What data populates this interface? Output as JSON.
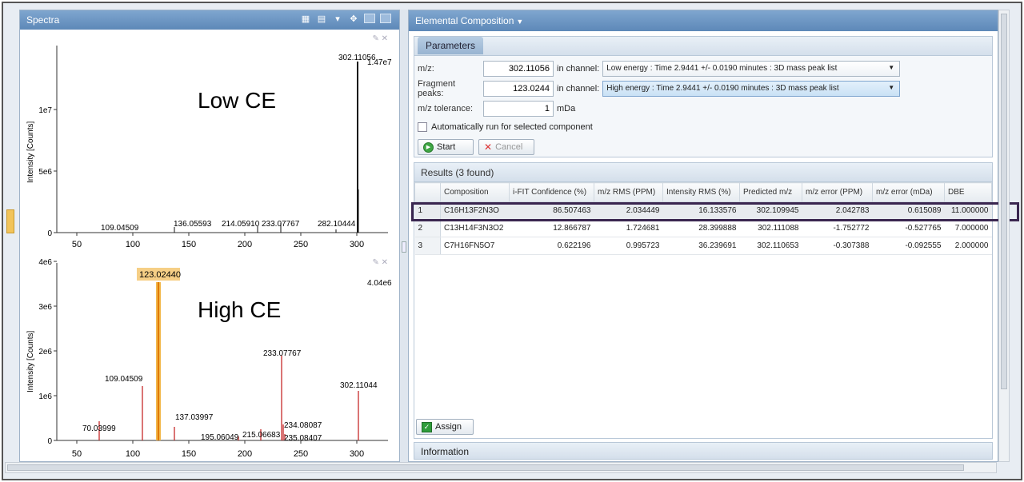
{
  "spectra_panel": {
    "title": "Spectra",
    "top_plot": {
      "label": "Low CE",
      "max_value_label": "1.47e7",
      "y_axis_title": "Intensity [Counts]",
      "y_ticks": [
        "0",
        "5e6",
        "1e7"
      ],
      "x_ticks": [
        "50",
        "100",
        "150",
        "200",
        "250",
        "300"
      ],
      "peak_labels": [
        "109.04509",
        "136.05593",
        "214.05910",
        "233.07767",
        "282.10444",
        "302.11056"
      ]
    },
    "bottom_plot": {
      "label": "High CE",
      "max_value_label": "4.04e6",
      "y_axis_title": "Intensity [Counts]",
      "y_ticks": [
        "0",
        "1e6",
        "2e6",
        "3e6",
        "4e6"
      ],
      "x_ticks": [
        "50",
        "100",
        "150",
        "200",
        "250",
        "300"
      ],
      "highlight_label": "123.02440",
      "peak_labels": [
        "70.03999",
        "109.04509",
        "137.03997",
        "195.06049",
        "215.06683",
        "233.07767",
        "234.08087",
        "235.08407",
        "302.11044"
      ]
    }
  },
  "elemental_composition": {
    "title": "Elemental Composition",
    "parameters": {
      "tab_label": "Parameters",
      "mz_label": "m/z:",
      "mz_value": "302.11056",
      "fragment_label": "Fragment peaks:",
      "fragment_value": "123.0244",
      "channel_label": "in channel:",
      "low_channel": "Low energy : Time 2.9441 +/- 0.0190 minutes : 3D mass peak list",
      "high_channel": "High energy : Time 2.9441 +/- 0.0190 minutes : 3D mass peak list",
      "tolerance_label": "m/z tolerance:",
      "tolerance_value": "1",
      "tolerance_unit": "mDa",
      "auto_run_label": "Automatically run for selected component",
      "start_label": "Start",
      "cancel_label": "Cancel"
    },
    "results": {
      "title": "Results (3 found)",
      "columns": [
        "Composition",
        "i-FIT Confidence (%)",
        "m/z RMS (PPM)",
        "Intensity RMS (%)",
        "Predicted m/z",
        "m/z error (PPM)",
        "m/z error (mDa)",
        "DBE"
      ],
      "rows": [
        {
          "index": "1",
          "composition": "C16H13F2N3O",
          "ifit": "86.507463",
          "mz_rms": "2.034449",
          "int_rms": "16.133576",
          "predicted": "302.109945",
          "err_ppm": "2.042783",
          "err_mda": "0.615089",
          "dbe": "11.000000"
        },
        {
          "index": "2",
          "composition": "C13H14F3N3O2",
          "ifit": "12.866787",
          "mz_rms": "1.724681",
          "int_rms": "28.399888",
          "predicted": "302.111088",
          "err_ppm": "-1.752772",
          "err_mda": "-0.527765",
          "dbe": "7.000000"
        },
        {
          "index": "3",
          "composition": "C7H16FN5O7",
          "ifit": "0.622196",
          "mz_rms": "0.995723",
          "int_rms": "36.239691",
          "predicted": "302.110653",
          "err_ppm": "-0.307388",
          "err_mda": "-0.092555",
          "dbe": "2.000000"
        }
      ],
      "assign_label": "Assign"
    },
    "information_label": "Information"
  }
}
